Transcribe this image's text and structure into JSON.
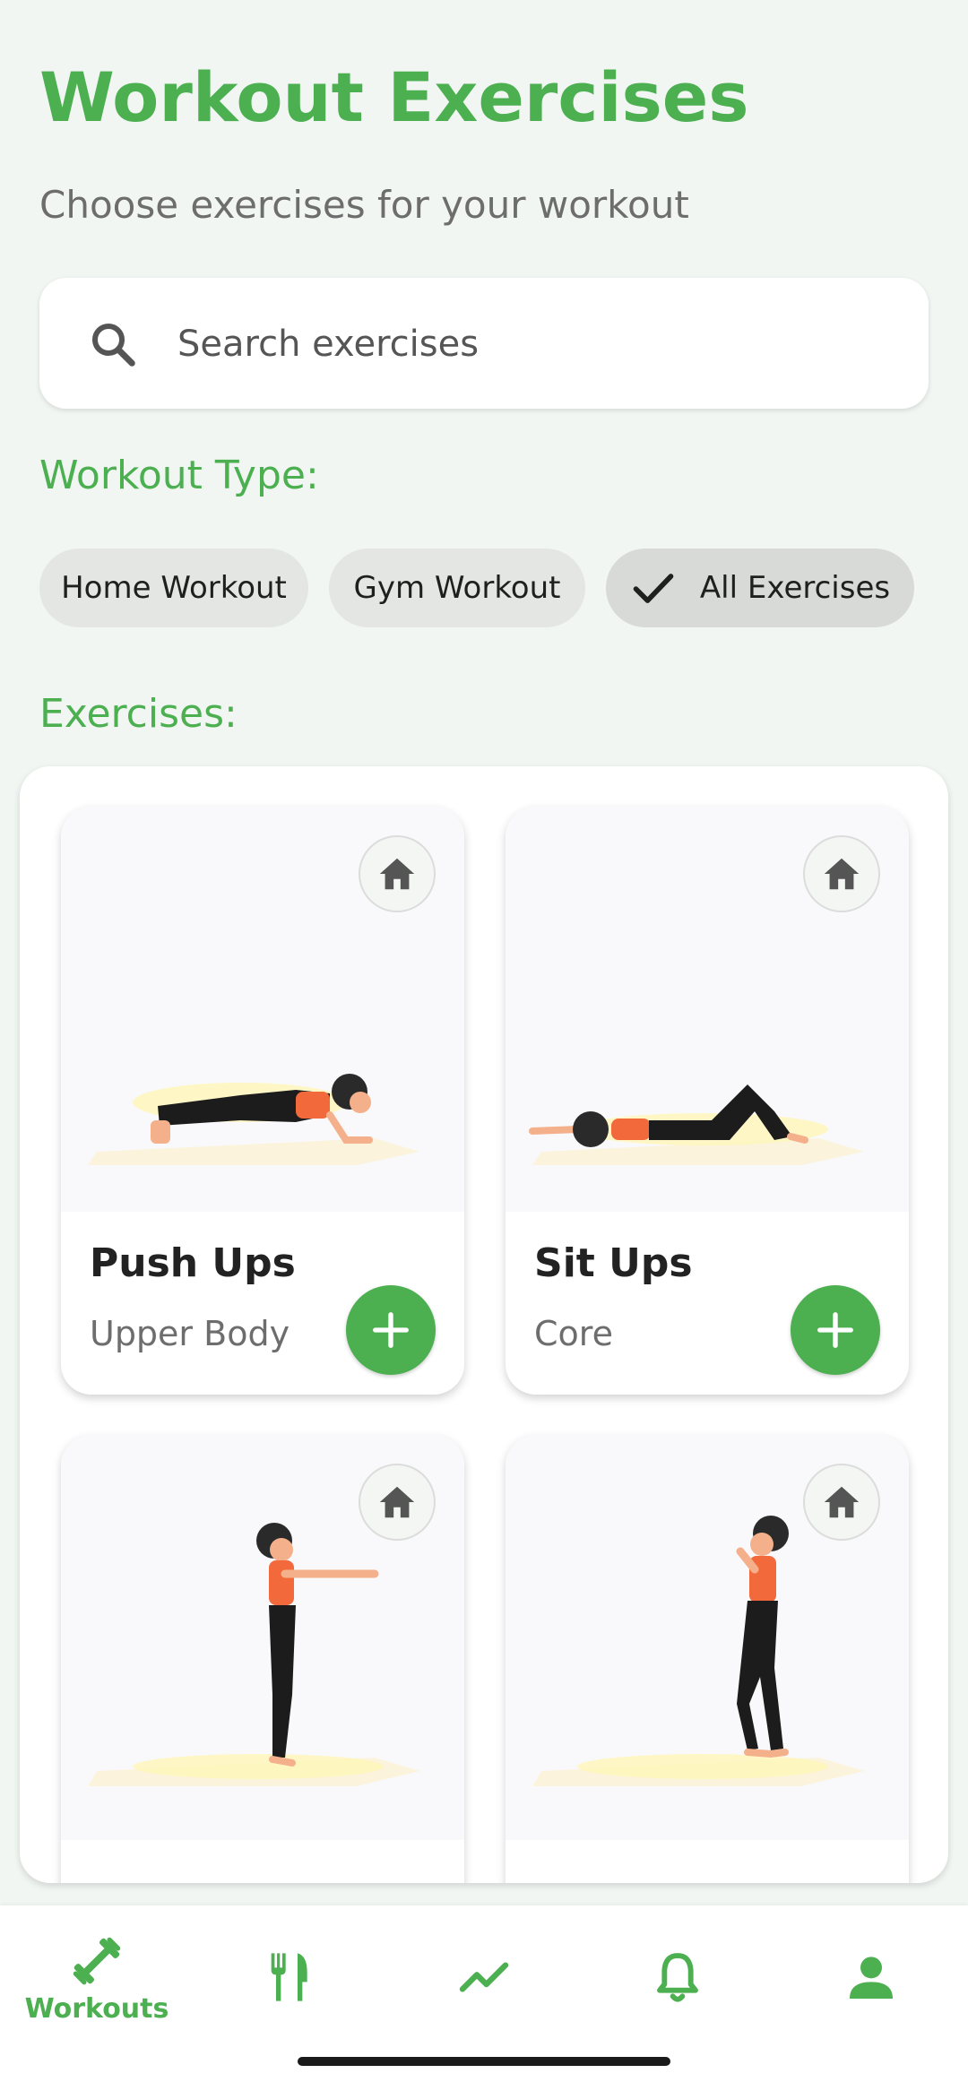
{
  "header": {
    "title": "Workout Exercises",
    "subtitle": "Choose exercises for your workout"
  },
  "search": {
    "placeholder": "Search exercises",
    "value": ""
  },
  "filters": {
    "label": "Workout Type:",
    "chips": [
      {
        "label": "Home Workout",
        "selected": false
      },
      {
        "label": "Gym Workout",
        "selected": false
      },
      {
        "label": "All Exercises",
        "selected": true
      }
    ]
  },
  "exercises": {
    "label": "Exercises:",
    "items": [
      {
        "name": "Push Ups",
        "category": "Upper Body",
        "badge_icon": "home-icon"
      },
      {
        "name": "Sit Ups",
        "category": "Core",
        "badge_icon": "home-icon"
      },
      {
        "name": "",
        "category": "",
        "badge_icon": "home-icon"
      },
      {
        "name": "",
        "category": "",
        "badge_icon": "home-icon"
      }
    ]
  },
  "bottom_nav": {
    "items": [
      {
        "icon": "dumbbell-icon",
        "label": "Workouts",
        "active": true
      },
      {
        "icon": "fork-knife-icon",
        "label": "",
        "active": false
      },
      {
        "icon": "trending-up-icon",
        "label": "",
        "active": false
      },
      {
        "icon": "bell-icon",
        "label": "",
        "active": false
      },
      {
        "icon": "person-icon",
        "label": "",
        "active": false
      }
    ]
  },
  "colors": {
    "accent": "#4caf50",
    "background": "#f1f6f3",
    "chip": "#e4e6e4"
  }
}
